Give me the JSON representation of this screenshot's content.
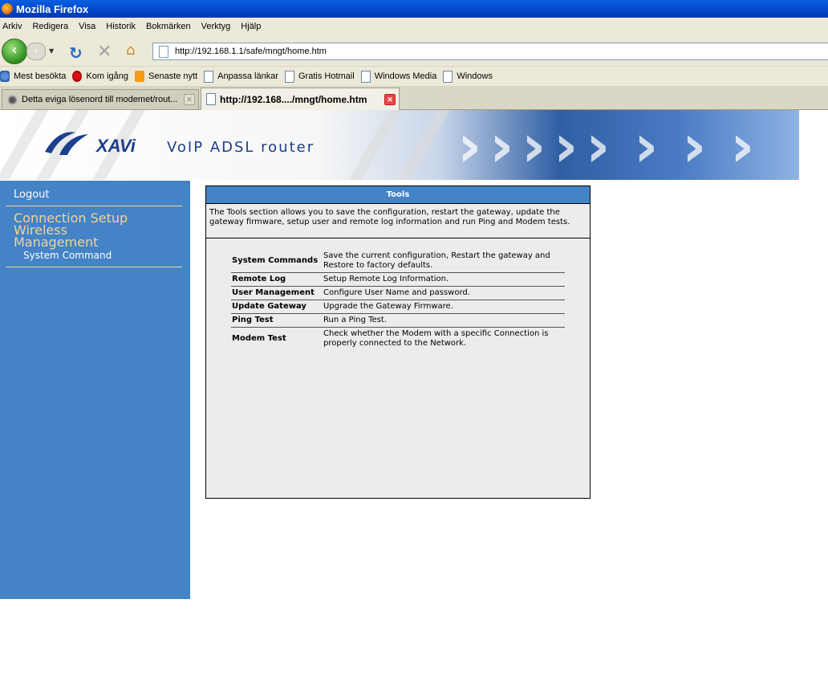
{
  "window": {
    "title": "Mozilla Firefox"
  },
  "menu": [
    "Arkiv",
    "Redigera",
    "Visa",
    "Historik",
    "Bokmärken",
    "Verktyg",
    "Hjälp"
  ],
  "address": {
    "url": "http://192.168.1.1/safe/mngt/home.htm"
  },
  "bookmarks": [
    {
      "label": "Mest besökta",
      "icon": "search-icon"
    },
    {
      "label": "Kom igång",
      "icon": "firefox-icon"
    },
    {
      "label": "Senaste nytt",
      "icon": "rss-icon"
    },
    {
      "label": "Anpassa länkar",
      "icon": "page-icon"
    },
    {
      "label": "Gratis Hotmail",
      "icon": "page-icon"
    },
    {
      "label": "Windows Media",
      "icon": "page-icon"
    },
    {
      "label": "Windows",
      "icon": "page-icon"
    }
  ],
  "tabs": [
    {
      "label": "Detta eviga lösenord till modemet/rout...",
      "active": false
    },
    {
      "label": "http://192.168..../mngt/home.htm",
      "active": true
    }
  ],
  "banner": {
    "logo": "XAVi",
    "product": "VoIP ADSL router"
  },
  "sidebar": {
    "logout": "Logout",
    "sections": [
      "Connection Setup",
      "Wireless",
      "Management"
    ],
    "sub": "System Command"
  },
  "tools": {
    "title": "Tools",
    "description": "The Tools section allows you to save the configuration, restart the gateway, update the gateway firmware, setup user and remote log information and run Ping and Modem tests.",
    "rows": [
      {
        "name": "System Commands",
        "desc": "Save the current configuration, Restart the gateway and Restore to factory defaults."
      },
      {
        "name": "Remote Log",
        "desc": "Setup Remote Log Information."
      },
      {
        "name": "User Management",
        "desc": "Configure User Name and password."
      },
      {
        "name": "Update Gateway",
        "desc": "Upgrade the Gateway Firmware."
      },
      {
        "name": "Ping Test",
        "desc": "Run a Ping Test."
      },
      {
        "name": "Modem Test",
        "desc": "Check whether the Modem with a specific Connection is properly connected to the Network."
      }
    ]
  },
  "colors": {
    "sidebar": "#4383c6",
    "accent": "#f3d39a",
    "panel_bg": "#ececec"
  }
}
